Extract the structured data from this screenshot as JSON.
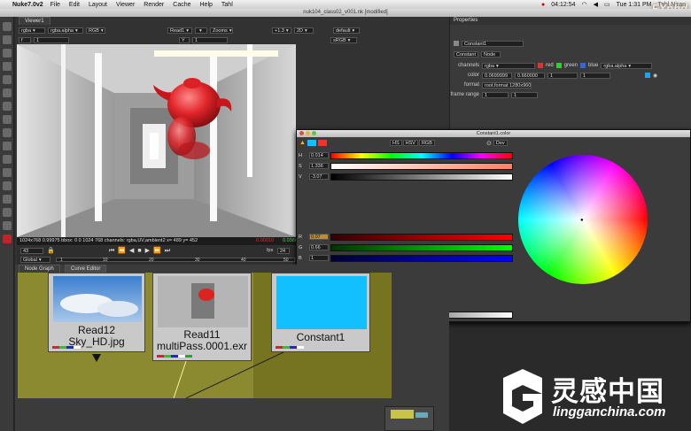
{
  "menubar": {
    "app": "Nuke7.0v2",
    "items": [
      "File",
      "Edit",
      "Layout",
      "Viewer",
      "Render",
      "Cache",
      "Help",
      "Tahl"
    ],
    "time": "04:12:54",
    "clock": "Tue 1:31 PM",
    "user": "Tahl Niran",
    "brand_logo": "FXphd"
  },
  "window_title": "nuk104_class02_v001.nk [modified]",
  "viewer": {
    "tab": "Viewer1",
    "row1": [
      "rgba",
      "rgba.alpha",
      "RGB",
      "Read1",
      "Zooms",
      "+1.3",
      "2D",
      "default"
    ],
    "row2": [
      "f",
      "1",
      "Y",
      "1",
      "sRGB"
    ],
    "info": "1024x768 0.99975 bbox: 0 0 1024 768 channels: rgba,UV,ambient2  x= 489 y= 452",
    "info_values": [
      "0.00010",
      "0.03863"
    ],
    "frame": "43",
    "fps": "24",
    "range_mode": "Global",
    "tick_marks": [
      "1",
      "10",
      "20",
      "30",
      "40",
      "50"
    ]
  },
  "node_graph": {
    "tabs": [
      "Node Graph",
      "Curve Editor"
    ],
    "nodes": [
      {
        "line1": "Read12",
        "line2": "Sky_HD.jpg"
      },
      {
        "line1": "Read11",
        "line2": "multiPass.0001.exr"
      },
      {
        "line1": "Constant1",
        "line2": ""
      }
    ]
  },
  "properties": {
    "header": "Properties",
    "node_name": "Constant1",
    "tabs": [
      "Constant",
      "Node"
    ],
    "channels_label": "channels",
    "channels_value": "rgba",
    "channel_flags": [
      "red",
      "green",
      "blue"
    ],
    "alpha_channel": "rgba.alpha",
    "color_label": "color",
    "color_values": [
      "0.0699999",
      "0.660000",
      "1",
      "1"
    ],
    "format_label": "format",
    "format_value": "root.format 1280x960",
    "frame_range_label": "frame range",
    "frame_range": [
      "1",
      "1"
    ]
  },
  "color_window": {
    "title": "Constant1.color",
    "modes": [
      "HS",
      "HSV",
      "RGB"
    ],
    "extra_button": "Dev",
    "hsv_rows": [
      {
        "label": "H",
        "value": "0.014"
      },
      {
        "label": "S",
        "value": "1.336"
      },
      {
        "label": "V",
        "value": "-3.07"
      }
    ],
    "rgb_rows": [
      {
        "label": "R",
        "value": "0.07"
      },
      {
        "label": "G",
        "value": "0.66"
      },
      {
        "label": "B",
        "value": "1"
      }
    ],
    "alpha_row": {
      "label": "A",
      "value": "1"
    }
  },
  "watermark": {
    "cn": "灵感中国",
    "en": "lingganchina.com"
  }
}
